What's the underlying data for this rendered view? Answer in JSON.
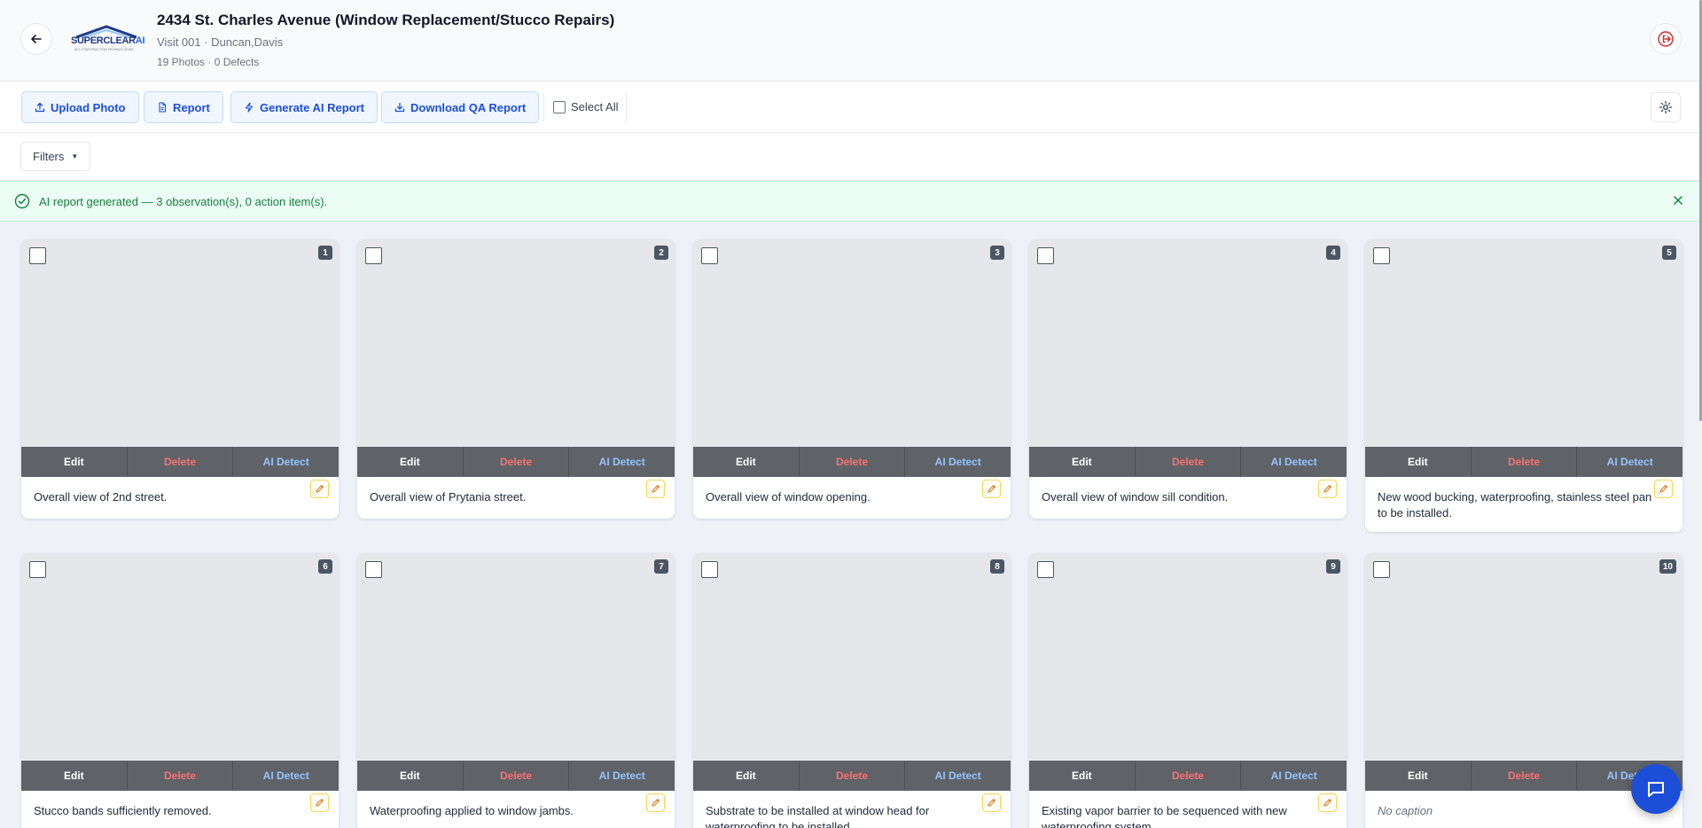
{
  "header": {
    "title": "2434 St. Charles Avenue (Window Replacement/Stucco Repairs)",
    "subtitle": "Visit 001 · Duncan,Davis",
    "meta": "19 Photos · 0 Defects",
    "logo_brand": "SUPERCLEAR",
    "logo_ai": "AI",
    "logo_tagline": "ACI CONSTRUCTION TECHNOLOGIES"
  },
  "toolbar": {
    "upload_label": "Upload Photo",
    "report_label": "Report",
    "generate_label": "Generate AI Report",
    "download_label": "Download QA Report",
    "select_all_label": "Select All"
  },
  "filters": {
    "label": "Filters"
  },
  "banner": {
    "text": "AI report generated — 3 observation(s), 0 action item(s).",
    "color": "#15803d"
  },
  "card_actions": {
    "edit": "Edit",
    "delete": "Delete",
    "detect": "AI Detect"
  },
  "cards": [
    {
      "number": "1",
      "caption": "Overall view of 2nd street."
    },
    {
      "number": "2",
      "caption": "Overall view of Prytania street."
    },
    {
      "number": "3",
      "caption": "Overall view of window opening."
    },
    {
      "number": "4",
      "caption": "Overall view of window sill condition."
    },
    {
      "number": "5",
      "caption": "New wood bucking, waterproofing, stainless steel pan to be installed."
    },
    {
      "number": "6",
      "caption": "Stucco bands sufficiently removed."
    },
    {
      "number": "7",
      "caption": "Waterproofing applied to window jambs."
    },
    {
      "number": "8",
      "caption": "Substrate to be installed at window head for waterproofing to be installed."
    },
    {
      "number": "9",
      "caption": "Existing vapor barrier to be sequenced with new waterproofing system."
    },
    {
      "number": "10",
      "caption": "No caption"
    }
  ],
  "colors": {
    "accent": "#1d4ed8",
    "card_action_bar": "#5f6368",
    "delete": "#f87171",
    "detect": "#93c5fd",
    "logout": "#dc2626"
  }
}
